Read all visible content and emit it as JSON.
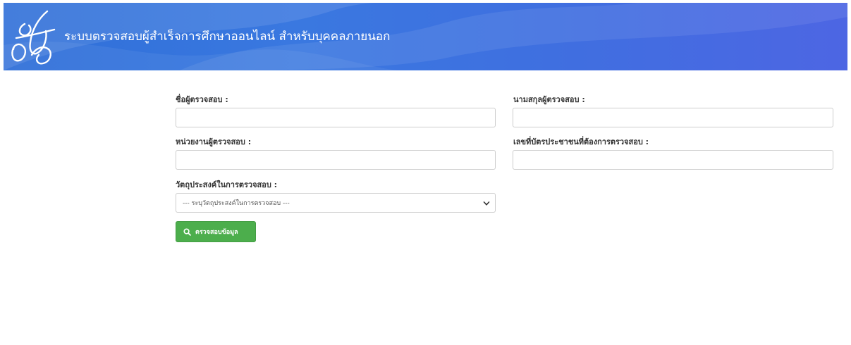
{
  "header": {
    "title": "ระบบตรวจสอบผู้สำเร็จการศึกษาออนไลน์ สำหรับบุคคลภายนอก",
    "logo_icon": "signature-logo-icon"
  },
  "form": {
    "first_name_label": "ชื่อผู้ตรวจสอบ :",
    "first_name_value": "",
    "last_name_label": "นามสกุลผู้ตรวจสอบ :",
    "last_name_value": "",
    "agency_label": "หน่วยงานผู้ตรวจสอบ :",
    "agency_value": "",
    "citizen_id_label": "เลขที่บัตรประชาชนที่ต้องการตรวจสอบ :",
    "citizen_id_value": "",
    "purpose_label": "วัตถุประสงค์ในการตรวจสอบ :",
    "purpose_selected": "--- ระบุวัตถุประสงค์ในการตรวจสอบ ---",
    "submit_label": "ตรวจสอบข้อมูล",
    "submit_icon": "search-icon"
  },
  "colors": {
    "header_blue": "#3a78e0",
    "button_green": "#4cae4c"
  }
}
